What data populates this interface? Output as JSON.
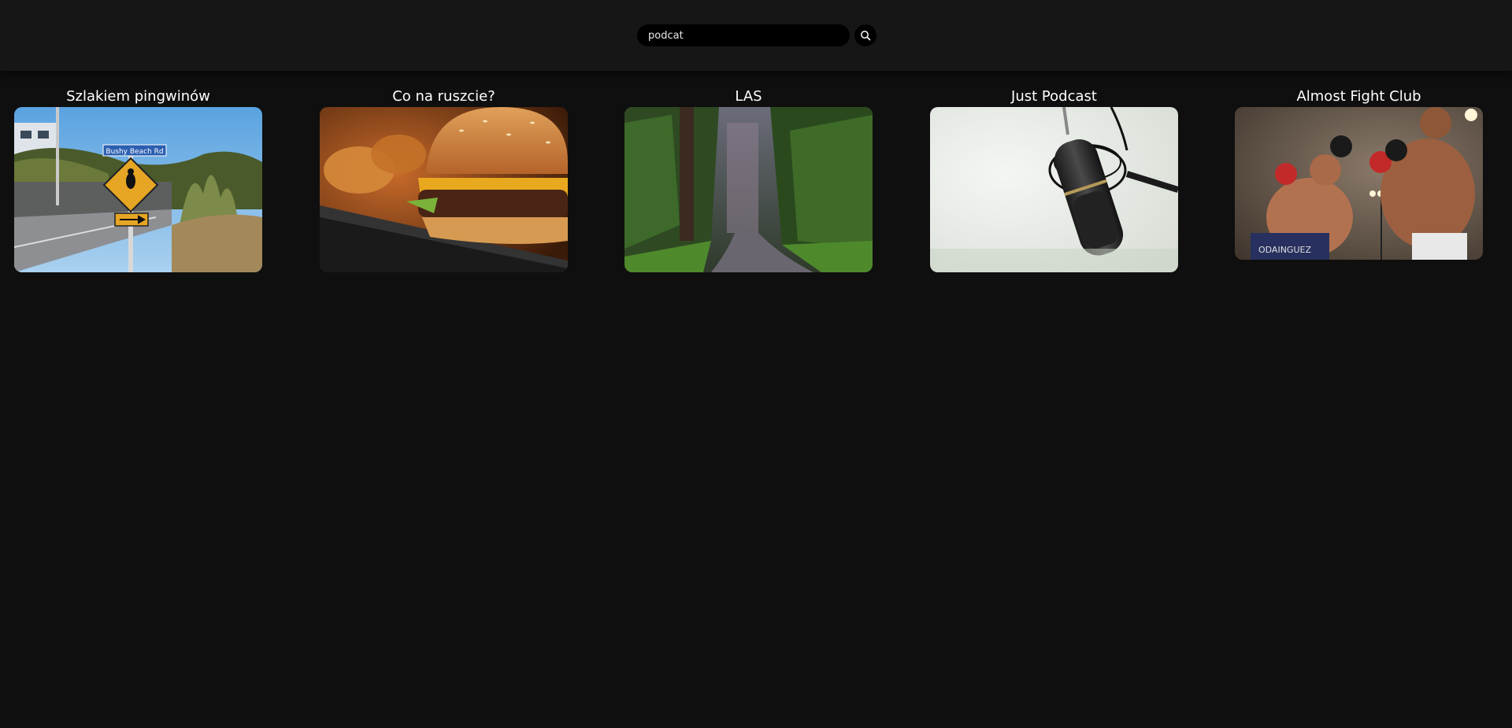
{
  "header": {
    "search": {
      "value": "podcat",
      "placeholder": ""
    },
    "search_button_icon": "search-icon"
  },
  "podcasts": [
    {
      "title": "Szlakiem pingwinów",
      "image": "penguin-road-sign-photo",
      "sign_text": "Bushy Beach Rd"
    },
    {
      "title": "Co na ruszcie?",
      "image": "cheeseburger-photo"
    },
    {
      "title": "LAS",
      "image": "forest-road-photo"
    },
    {
      "title": "Just Podcast",
      "image": "studio-microphone-photo"
    },
    {
      "title": "Almost Fight Club",
      "image": "boxing-match-photo"
    }
  ],
  "colors": {
    "background": "#0f0f0f",
    "header_background": "#161616",
    "search_background": "#000000",
    "text": "#ffffff"
  }
}
